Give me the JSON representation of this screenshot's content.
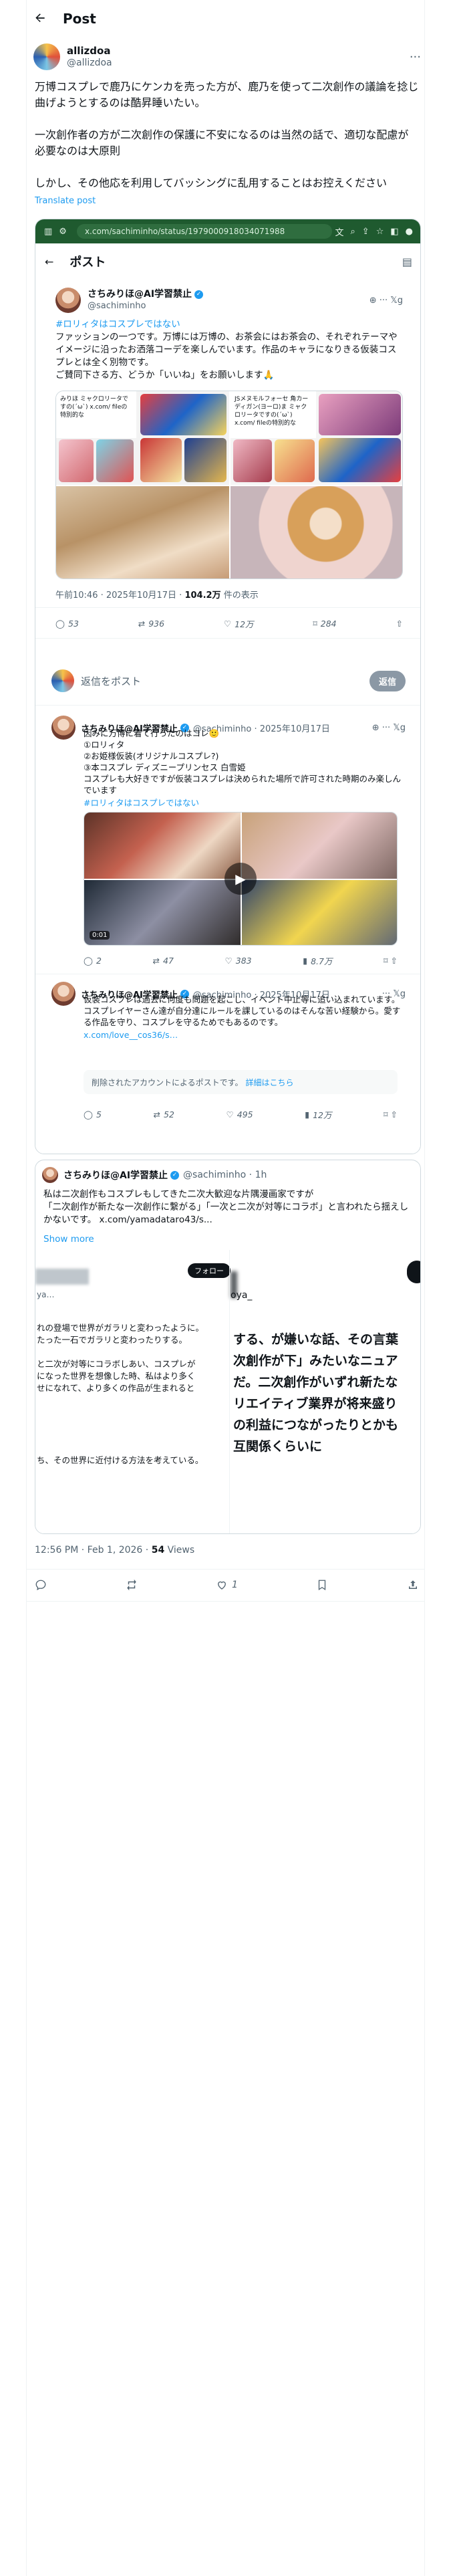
{
  "header": {
    "back_icon": "arrow-left-icon",
    "title": "Post"
  },
  "post": {
    "display_name": "allizdoa",
    "handle": "@allizdoa",
    "more": "···",
    "text": "万博コスプレで鹿乃にケンカを売った方が、鹿乃を使って二次創作の議論を捻じ曲げようとするのは酷昇睡いたい。\n\n一次創作者の方が二次創作の保護に不安になるのは当然の話で、適切な配慮が必要なのは大原則\n\nしかし、その他応を利用してバッシングに乱用することはお控えください",
    "translate": "Translate post"
  },
  "browser": {
    "url": "x.com/sachiminho/status/1979000918034071988"
  },
  "inner_post": {
    "header_title": "ポスト",
    "display_name": "さちみりほ@AI学習禁止",
    "handle": "@sachiminho",
    "controls": "⊕ ··· 𝕏g",
    "text_hashtag": "#ロリィタはコスプレではない",
    "text": "ファッションの一つです。万博には万博の、お茶会にはお茶会の、それぞれテーマやイメージに沿ったお洒落コーデを楽しんでいます。作品のキャラになりきる仮装コスプレとは全く別物です。\nご賛同下さる方、どうか「いいね」をお願いします🙏",
    "card1_text": "みりほ\nミャクロリータですの(´ω`) x.com/\nfileの特別的な",
    "card2_text": "JSメヌモルフォーセ\n角カーディガン(ヨーロ)ま\nミャクロリータですの(´ω`) x.com/\nfileの特別的な",
    "meta_time": "午前10:46 · 2025年10月17日 · ",
    "meta_views": "104.2万",
    "meta_views_suffix": " 件の表示",
    "replies": "53",
    "reposts": "936",
    "likes": "12万",
    "bookmarks": "284"
  },
  "reply_box": {
    "placeholder": "返信をポスト",
    "button": "返信"
  },
  "reply1": {
    "display_name": "さちみりほ@AI学習禁止",
    "handle": "@sachiminho · 2025年10月17日",
    "controls": "⊕ ··· 𝕏g",
    "text": "因みに万博に着て行ったのはコレ🙂\n①ロリィタ\n②お姫様仮装(オリジナルコスプレ?)\n③本コスプレ ディズニープリンセス 白雪姫\nコスプレも大好きですが仮装コスプレは決められた場所で許可された時期のみ楽しんでいます",
    "hashtag": "#ロリィタはコスプレではない",
    "duration": "0:01",
    "replies": "2",
    "reposts": "47",
    "likes": "383",
    "views": "8.7万"
  },
  "reply2": {
    "display_name": "さちみりほ@AI学習禁止",
    "handle": "@sachiminho · 2025年10月17日",
    "controls": "··· 𝕏g",
    "text": "仮装コスプレは過去に何度も問題を起こし、イベント中止等に追い込まれています。\nコスプレイヤーさん達が自分達にルールを課しているのはそんな苦い経験から。愛する作品を守り、コスプレを守るためでもあるのです。",
    "link": "x.com/love__cos36/s…",
    "deleted_text": "削除されたアカウントによるポストです。",
    "deleted_link": "詳細はこちら",
    "replies": "5",
    "reposts": "52",
    "likes": "495",
    "views": "12万"
  },
  "quote": {
    "display_name": "さちみりほ@AI学習禁止",
    "handle": "@sachiminho · 1h",
    "text": "私は二次創作もコスプレもしてきた二次大歓迎な片隅漫画家ですが\n「二次創作が新たな一次創作に繋がる」「一次と二次が対等にコラボ」と言われたら揺えしかないです。 x.com/yamadatarо43/s...",
    "show_more": "Show more",
    "follow": "フォロー",
    "left_name": "ya…",
    "right_name": "oya_",
    "left_text": "れの登場で世界がガラリと変わったように。\nたった一石でガラリと変わったりする。\n\nと二次が対等にコラボしあい、コスプレが\nになった世界を想像した時、私はより多く\nせになれて、より多くの作品が生まれると",
    "right_text": "する、が嫌いな話、その言葉\n次創作が下」みたいなニュア\nだ。二次創作がいずれ新たな\nリエイティブ業界が将来盛り\nの利益につながったりとかも\n互関係くらいに",
    "left_text2": "ち、その世界に近付ける方法を考えている。"
  },
  "footer": {
    "time": "12:56 PM · Feb 1, 2026 · ",
    "views": "54",
    "views_label": " Views",
    "likes": "1"
  }
}
